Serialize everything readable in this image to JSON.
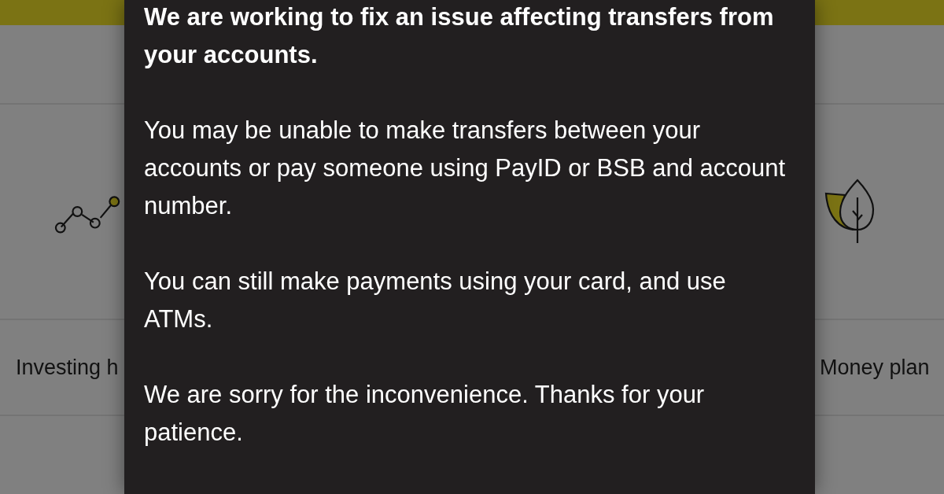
{
  "tiles": [
    {
      "label": "Investing h"
    },
    {
      "label": "Money plan"
    }
  ],
  "alert": {
    "heading": "We are working to fix an issue affecting transfers from your accounts.",
    "paragraphs": [
      "You may be unable to make transfers between your accounts or pay someone using PayID or BSB and account number.",
      "You can still make payments using your card, and use ATMs.",
      "We are sorry for the inconvenience. Thanks for your patience."
    ]
  }
}
